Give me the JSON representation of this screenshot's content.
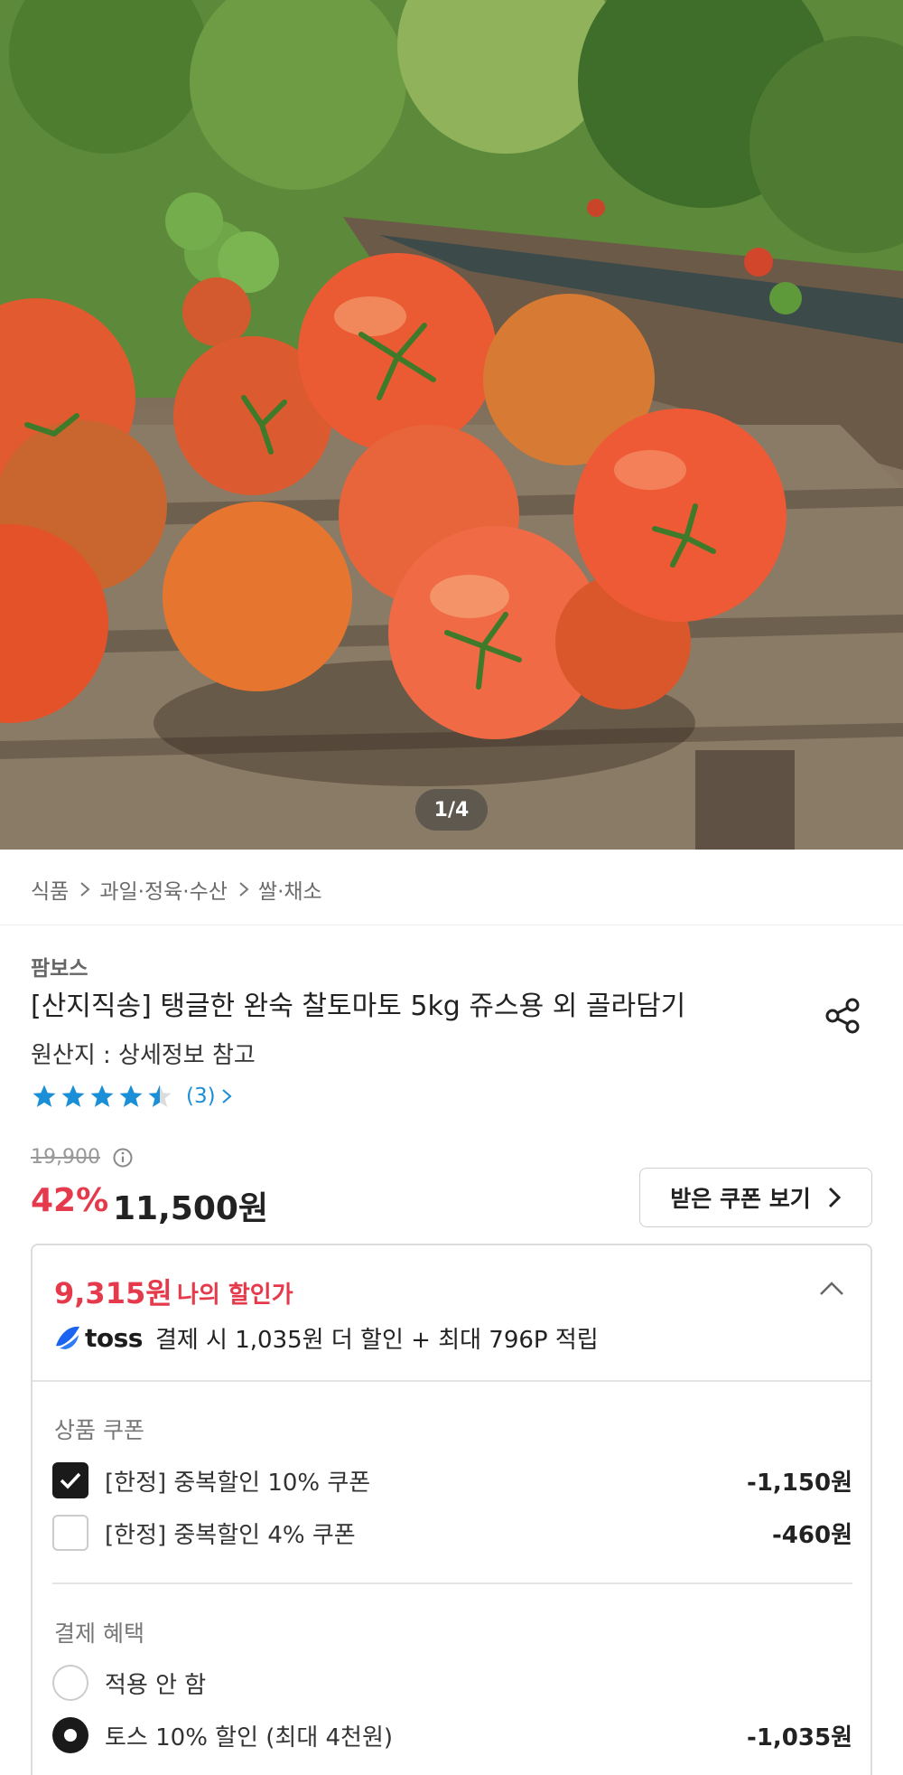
{
  "hero": {
    "image_alt": "tomatoes",
    "counter": "1/4"
  },
  "breadcrumb": [
    "식품",
    "과일·정육·수산",
    "쌀·채소"
  ],
  "product": {
    "seller": "팜보스",
    "title": "[산지직송] 탱글한 완숙 찰토마토 5kg 쥬스용 외 골라담기",
    "origin": "원산지 : 상세정보 참고",
    "rating": 4.5,
    "review_count": "(3)"
  },
  "price": {
    "original": "19,900",
    "discount_rate": "42%",
    "sale": "11,500원",
    "coupon_button": "받은 쿠폰 보기"
  },
  "benefit": {
    "my_price": "9,315원",
    "my_price_label": "나의 할인가",
    "toss_word": "toss",
    "toss_text": "결제 시 1,035원 더 할인 + 최대 796P 적립",
    "coupon_section_title": "상품 쿠폰",
    "coupons": [
      {
        "name": "[한정] 중복할인 10% 쿠폰",
        "amount": "-1,150원",
        "checked": true
      },
      {
        "name": "[한정] 중복할인 4% 쿠폰",
        "amount": "-460원",
        "checked": false
      }
    ],
    "payment_section_title": "결제 혜택",
    "payment_options": [
      {
        "name": "적용 안 함",
        "amount": "",
        "selected": false
      },
      {
        "name": "토스 10% 할인 (최대 4천원)",
        "amount": "-1,035원",
        "selected": true
      }
    ]
  },
  "colors": {
    "accent_red": "#e5394c",
    "star_blue": "#1a8fd8",
    "toss_blue": "#1b64f2"
  }
}
